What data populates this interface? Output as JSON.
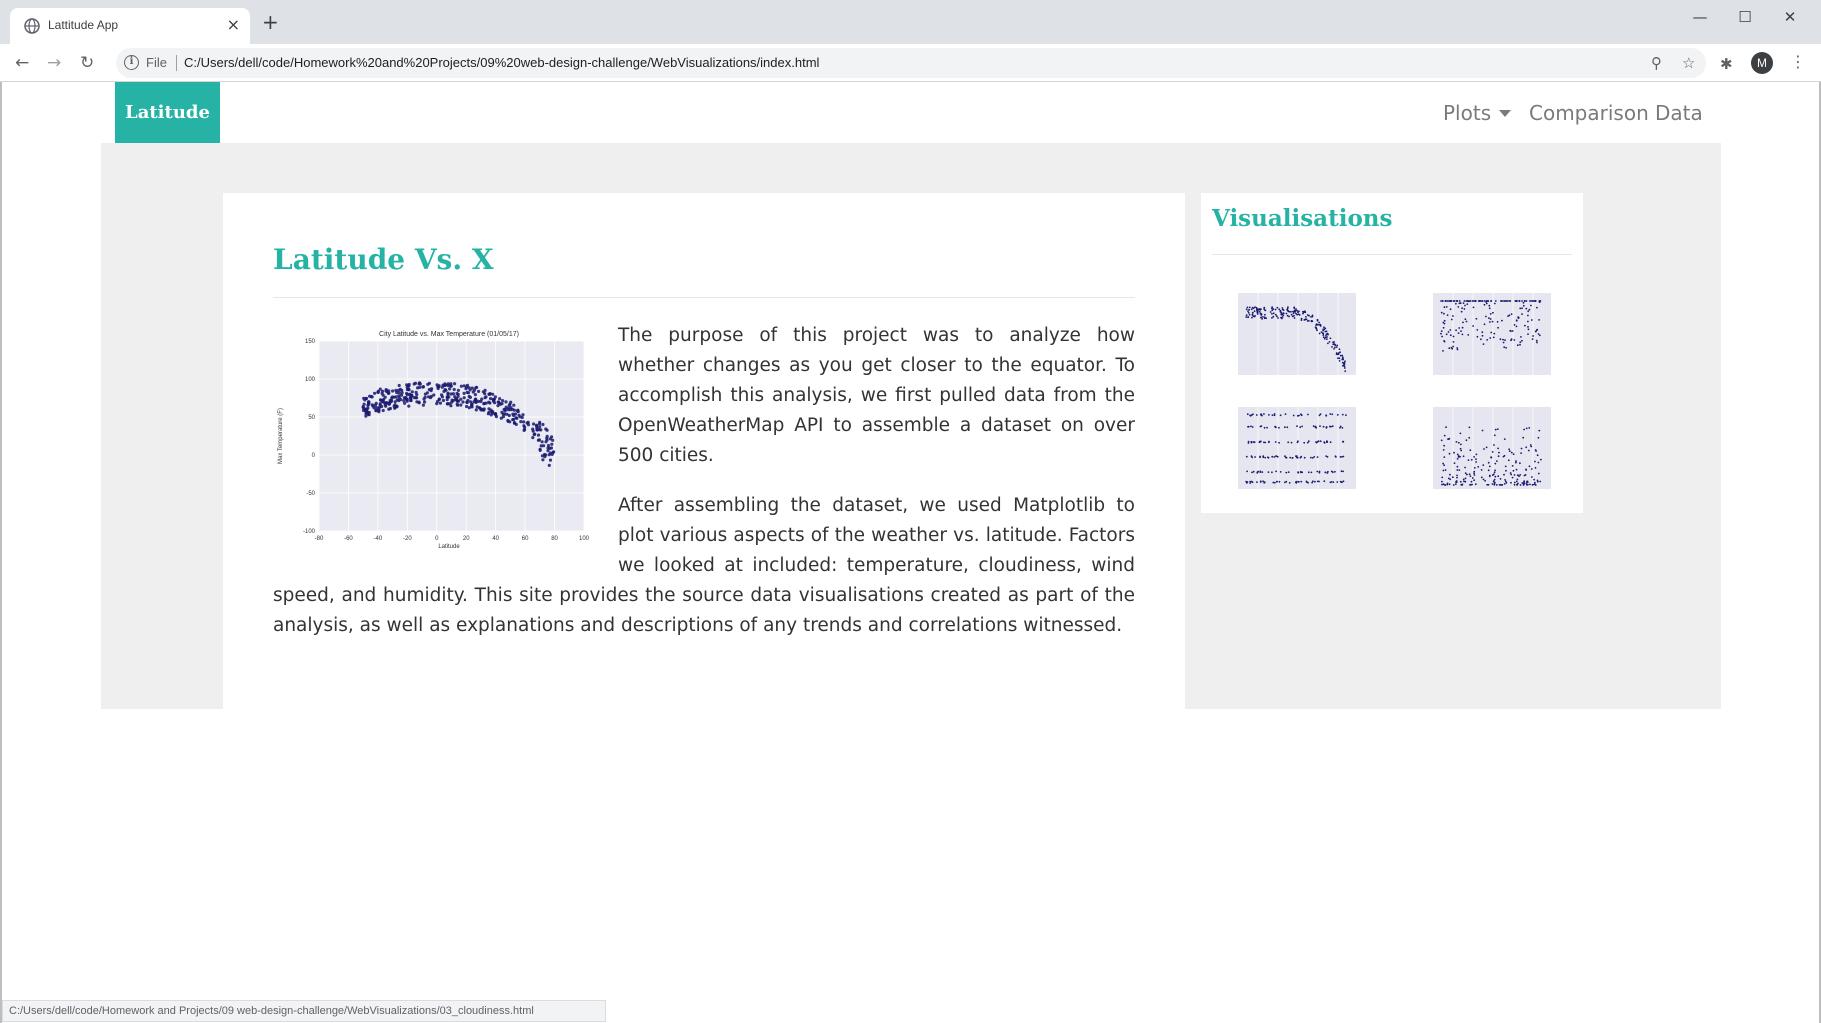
{
  "browser": {
    "tab_title": "Lattitude App",
    "close_glyph": "×",
    "new_tab_glyph": "+",
    "minimize_glyph": "—",
    "maximize_glyph": "☐",
    "window_close_glyph": "✕",
    "back_glyph": "←",
    "forward_glyph": "→",
    "reload_glyph": "↻",
    "info_glyph": "i",
    "file_label": "File",
    "url": "C:/Users/dell/code/Homework%20and%20Projects/09%20web-design-challenge/WebVisualizations/index.html",
    "zoom_glyph": "⚲",
    "star_glyph": "☆",
    "extension_glyph": "✱",
    "profile_initial": "M",
    "menu_glyph": "⋮",
    "status_url": "C:/Users/dell/code/Homework and Projects/09 web-design-challenge/WebVisualizations/03_cloudiness.html"
  },
  "site": {
    "brand": "Latitude",
    "nav": {
      "plots": "Plots",
      "comparison": "Comparison",
      "data": "Data"
    },
    "accent_color": "#26b3a6",
    "main": {
      "heading": "Latitude Vs. X",
      "paragraph_1": "The purpose of this project was to analyze how whether changes as you get closer to the equator. To accomplish this analysis, we first pulled data from the OpenWeatherMap API to assemble a dataset on over 500 cities.",
      "paragraph_2": "After assembling the dataset, we used Matplotlib to plot various aspects of the weather vs. latitude. Factors we looked at included: temperature, cloudiness, wind speed, and humidity. This site provides the source data visualisations created as part of the analysis, as well as explanations and descriptions of any trends and correlations witnessed.",
      "figure": {
        "title": "City Latitude vs. Max Temperature (01/05/17)",
        "xlabel": "Latitude",
        "ylabel": "Max Temperature (F)",
        "x_ticks": [
          "-80",
          "-60",
          "-40",
          "-20",
          "0",
          "20",
          "40",
          "60",
          "80",
          "100"
        ],
        "y_ticks": [
          "150",
          "100",
          "50",
          "0",
          "-50",
          "-100"
        ]
      }
    },
    "sidebar": {
      "title": "Visualisations",
      "thumbnails": [
        {
          "name": "max-temperature"
        },
        {
          "name": "humidity"
        },
        {
          "name": "cloudiness"
        },
        {
          "name": "wind-speed"
        }
      ]
    }
  }
}
